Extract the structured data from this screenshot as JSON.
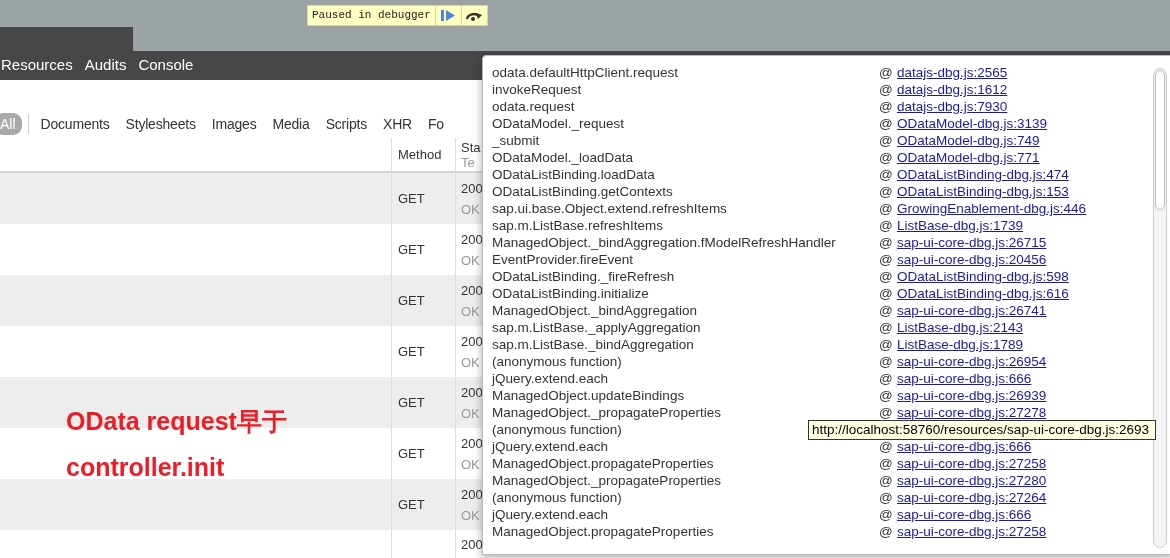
{
  "debugger_banner": {
    "text": "Paused in debugger"
  },
  "panel_tabs": [
    {
      "label": "Resources"
    },
    {
      "label": "Audits"
    },
    {
      "label": "Console"
    }
  ],
  "filter_tabs": [
    {
      "label": "All",
      "selected": true
    },
    {
      "label": "Documents",
      "selected": false
    },
    {
      "label": "Stylesheets",
      "selected": false
    },
    {
      "label": "Images",
      "selected": false
    },
    {
      "label": "Media",
      "selected": false
    },
    {
      "label": "Scripts",
      "selected": false
    },
    {
      "label": "XHR",
      "selected": false
    },
    {
      "label": "Fo",
      "selected": false
    }
  ],
  "table": {
    "columns": [
      {
        "label": "Method"
      },
      {
        "label": "Sta",
        "sublabel": "Te"
      }
    ],
    "rows": [
      {
        "method": "GET",
        "status": "200",
        "text": "OK"
      },
      {
        "method": "GET",
        "status": "200",
        "text": "OK"
      },
      {
        "method": "GET",
        "status": "200",
        "text": "OK"
      },
      {
        "method": "GET",
        "status": "200",
        "text": "OK"
      },
      {
        "method": "GET",
        "status": "200",
        "text": "OK"
      },
      {
        "method": "GET",
        "status": "200",
        "text": "OK"
      },
      {
        "method": "GET",
        "status": "200",
        "text": "OK"
      },
      {
        "status": "200"
      }
    ]
  },
  "annotation": {
    "lines": [
      "OData request早于",
      "controller.init"
    ]
  },
  "call_stack": [
    {
      "function": "odata.defaultHttpClient.request",
      "at": "@",
      "link": "datajs-dbg.js:2565"
    },
    {
      "function": "invokeRequest",
      "at": "@",
      "link": "datajs-dbg.js:1612"
    },
    {
      "function": "odata.request",
      "at": "@",
      "link": "datajs-dbg.js:7930"
    },
    {
      "function": "ODataModel._request",
      "at": "@",
      "link": "ODataModel-dbg.js:3139"
    },
    {
      "function": "_submit",
      "at": "@",
      "link": "ODataModel-dbg.js:749"
    },
    {
      "function": "ODataModel._loadData",
      "at": "@",
      "link": "ODataModel-dbg.js:771"
    },
    {
      "function": "ODataListBinding.loadData",
      "at": "@",
      "link": "ODataListBinding-dbg.js:474"
    },
    {
      "function": "ODataListBinding.getContexts",
      "at": "@",
      "link": "ODataListBinding-dbg.js:153"
    },
    {
      "function": "sap.ui.base.Object.extend.refreshItems",
      "at": "@",
      "link": "GrowingEnablement-dbg.js:446"
    },
    {
      "function": "sap.m.ListBase.refreshItems",
      "at": "@",
      "link": "ListBase-dbg.js:1739"
    },
    {
      "function": "ManagedObject._bindAggregation.fModelRefreshHandler",
      "at": "@",
      "link": "sap-ui-core-dbg.js:26715"
    },
    {
      "function": "EventProvider.fireEvent",
      "at": "@",
      "link": "sap-ui-core-dbg.js:20456"
    },
    {
      "function": "ODataListBinding._fireRefresh",
      "at": "@",
      "link": "ODataListBinding-dbg.js:598"
    },
    {
      "function": "ODataListBinding.initialize",
      "at": "@",
      "link": "ODataListBinding-dbg.js:616"
    },
    {
      "function": "ManagedObject._bindAggregation",
      "at": "@",
      "link": "sap-ui-core-dbg.js:26741"
    },
    {
      "function": "sap.m.ListBase._applyAggregation",
      "at": "@",
      "link": "ListBase-dbg.js:2143"
    },
    {
      "function": "sap.m.ListBase._bindAggregation",
      "at": "@",
      "link": "ListBase-dbg.js:1789"
    },
    {
      "function": "(anonymous function)",
      "at": "@",
      "link": "sap-ui-core-dbg.js:26954"
    },
    {
      "function": "jQuery.extend.each",
      "at": "@",
      "link": "sap-ui-core-dbg.js:666"
    },
    {
      "function": "ManagedObject.updateBindings",
      "at": "@",
      "link": "sap-ui-core-dbg.js:26939"
    },
    {
      "function": "ManagedObject._propagateProperties",
      "at": "@",
      "link": "sap-ui-core-dbg.js:27278"
    },
    {
      "function": "(anonymous function)"
    },
    {
      "function": "jQuery.extend.each",
      "at": "@",
      "link": "sap-ui-core-dbg.js:666"
    },
    {
      "function": "ManagedObject.propagateProperties",
      "at": "@",
      "link": "sap-ui-core-dbg.js:27258"
    },
    {
      "function": "ManagedObject._propagateProperties",
      "at": "@",
      "link": "sap-ui-core-dbg.js:27280"
    },
    {
      "function": "(anonymous function)",
      "at": "@",
      "link": "sap-ui-core-dbg.js:27264"
    },
    {
      "function": "jQuery.extend.each",
      "at": "@",
      "link": "sap-ui-core-dbg.js:666"
    },
    {
      "function": "ManagedObject.propagateProperties",
      "at": "@",
      "link": "sap-ui-core-dbg.js:27258"
    }
  ],
  "tooltip": {
    "text": "http://localhost:58760/resources/sap-ui-core-dbg.js:2693"
  }
}
